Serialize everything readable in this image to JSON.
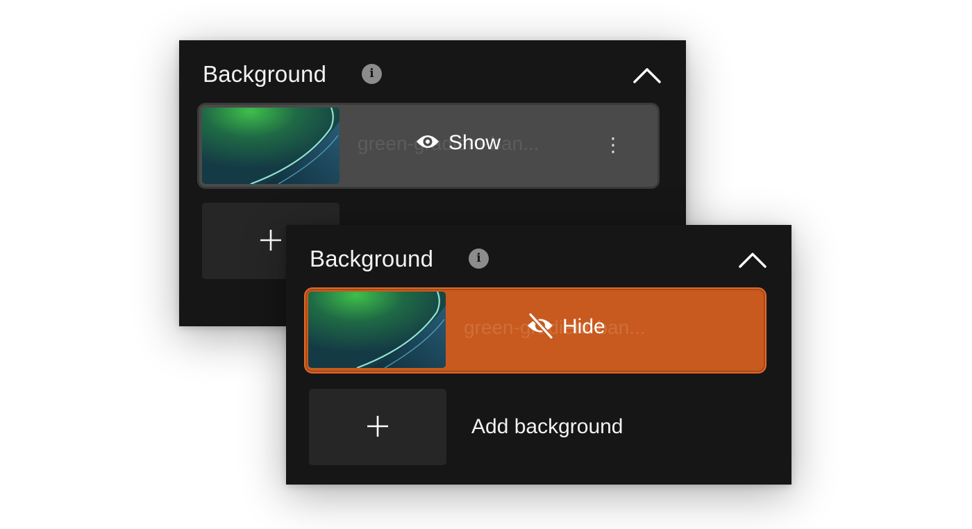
{
  "panels": [
    {
      "state": "hover",
      "header": {
        "title": "Background",
        "info_icon": "info-icon",
        "collapse_icon": "chevron-up-icon"
      },
      "item": {
        "name": "green-gradient-banner",
        "name_display": "green-gradient-ban...",
        "action_label": "Show",
        "action_icon": "eye-icon",
        "more_icon": "more-vertical-icon",
        "more_glyph": "⋮"
      },
      "add": {
        "icon": "plus-icon"
      }
    },
    {
      "state": "active",
      "header": {
        "title": "Background",
        "info_icon": "info-icon",
        "collapse_icon": "chevron-up-icon"
      },
      "item": {
        "name": "green-gradient-banner",
        "name_display": "green-gradient-ban...",
        "action_label": "Hide",
        "action_icon": "eye-off-icon"
      },
      "add": {
        "icon": "plus-icon",
        "label": "Add background"
      }
    }
  ],
  "colors": {
    "panel_bg": "#161616",
    "hover_item_bg": "#4a4a4a",
    "active_item_bg": "#c85a1f",
    "tile_bg": "#262626",
    "text": "#f2f2f2"
  }
}
